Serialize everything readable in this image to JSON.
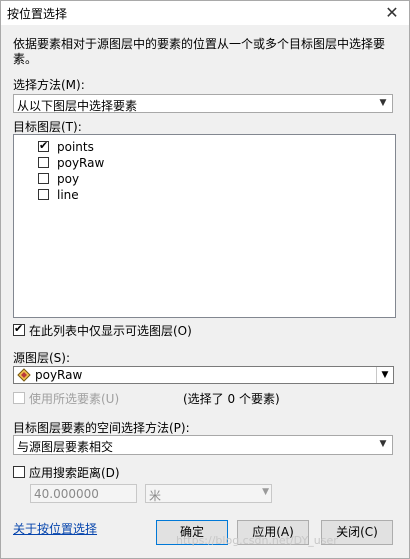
{
  "window": {
    "title": "按位置选择",
    "close_glyph": "✕"
  },
  "description": "依据要素相对于源图层中的要素的位置从一个或多个目标图层中选择要素。",
  "selection_method": {
    "label": "选择方法(M):",
    "value": "从以下图层中选择要素"
  },
  "target_layers": {
    "label": "目标图层(T):",
    "items": [
      {
        "label": "points",
        "checked": true
      },
      {
        "label": "poyRaw",
        "checked": false
      },
      {
        "label": "poy",
        "checked": false
      },
      {
        "label": "line",
        "checked": false
      }
    ]
  },
  "only_selectable": {
    "label": "在此列表中仅显示可选图层(O)",
    "checked": true
  },
  "source_layer": {
    "label": "源图层(S):",
    "value": "poyRaw",
    "icon": "polygon-layer-icon"
  },
  "use_selected": {
    "label": "使用所选要素(U)",
    "checked": false,
    "enabled": false
  },
  "selected_count_text": "(选择了 0 个要素)",
  "spatial_method": {
    "label": "目标图层要素的空间选择方法(P):",
    "value": "与源图层要素相交"
  },
  "search_distance": {
    "label": "应用搜索距离(D)",
    "checked": false,
    "value": "40.000000",
    "unit": "米"
  },
  "help_link": "关于按位置选择",
  "buttons": {
    "ok": "确定",
    "apply": "应用(A)",
    "close": "关闭(C)"
  },
  "watermark": "https://blog.csdn.net/DY_user"
}
